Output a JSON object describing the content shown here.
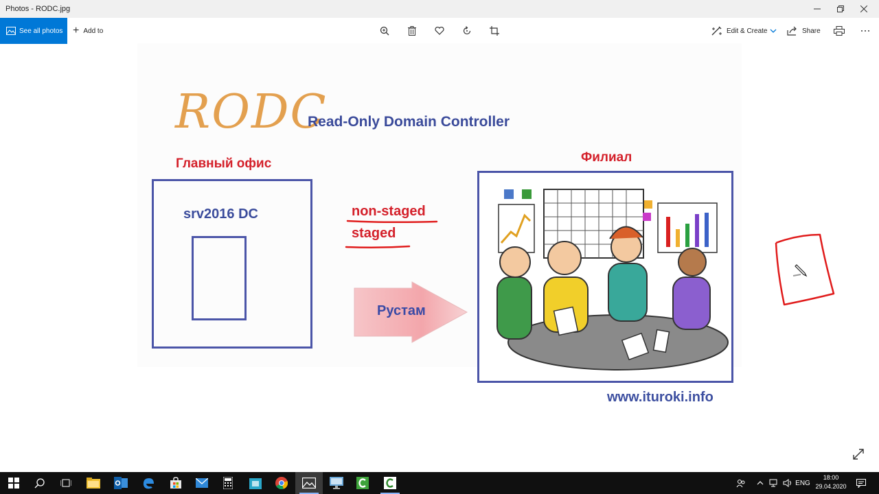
{
  "window": {
    "title": "Photos - RODC.jpg"
  },
  "commandbar": {
    "see_all": "See all photos",
    "add_to": "Add to",
    "edit_create": "Edit & Create",
    "share": "Share"
  },
  "slide": {
    "logo": "RODC",
    "subtitle": "Read-Only Domain Controller",
    "main_office": "Главный офис",
    "branch": "Филиал",
    "server": "srv2016 DC",
    "option1": "non-staged",
    "option2": "staged",
    "arrow_label": "Рустам",
    "url": "www.ituroki.info"
  },
  "taskbar": {
    "language": "ENG",
    "time": "18:00",
    "date": "29.04.2020"
  },
  "colors": {
    "accent": "#0078d7",
    "slide_blue": "#4b55a8",
    "slide_red": "#d4202a",
    "logo_orange": "#e3a04f"
  }
}
